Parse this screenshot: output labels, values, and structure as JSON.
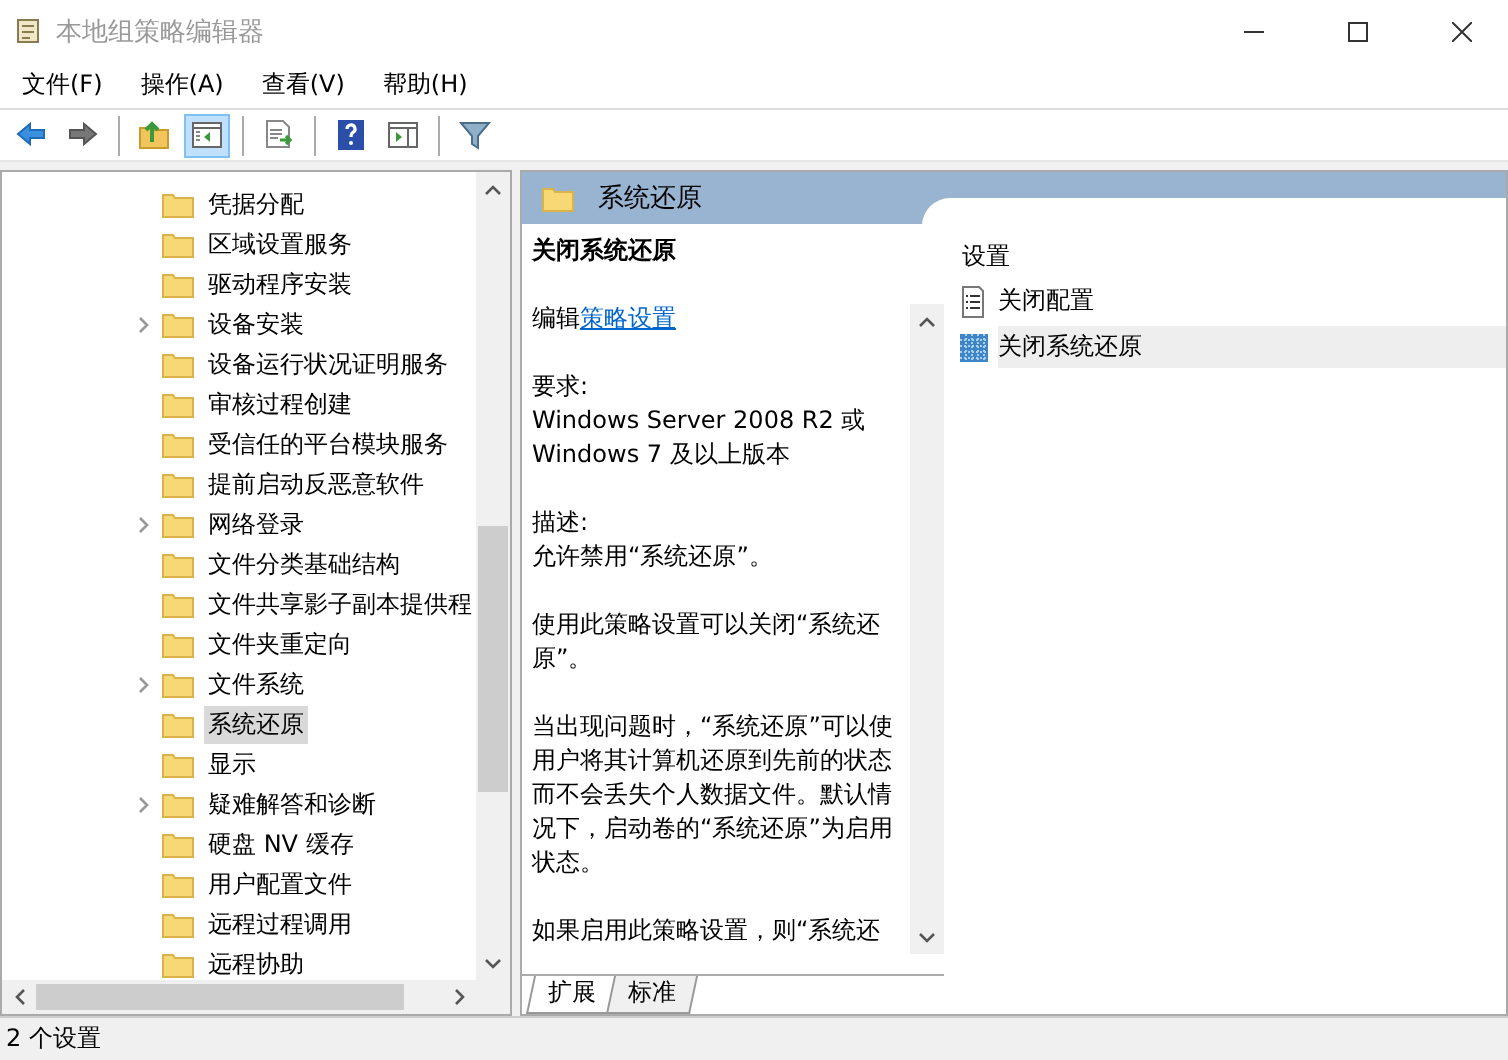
{
  "window": {
    "title": "本地组策略编辑器"
  },
  "menu": [
    "文件(F)",
    "操作(A)",
    "查看(V)",
    "帮助(H)"
  ],
  "toolbar": [
    [
      {
        "kind": "back",
        "selected": false
      },
      {
        "kind": "forward",
        "selected": false
      }
    ],
    [
      {
        "kind": "up",
        "selected": false
      },
      {
        "kind": "tree",
        "selected": true
      }
    ],
    [
      {
        "kind": "export",
        "selected": false
      }
    ],
    [
      {
        "kind": "help",
        "selected": false
      },
      {
        "kind": "panel",
        "selected": false
      }
    ],
    [
      {
        "kind": "filter",
        "selected": false
      }
    ]
  ],
  "tree": {
    "items": [
      {
        "label": "凭据分配",
        "expandable": false,
        "selected": false
      },
      {
        "label": "区域设置服务",
        "expandable": false,
        "selected": false
      },
      {
        "label": "驱动程序安装",
        "expandable": false,
        "selected": false
      },
      {
        "label": "设备安装",
        "expandable": true,
        "selected": false
      },
      {
        "label": "设备运行状况证明服务",
        "expandable": false,
        "selected": false
      },
      {
        "label": "审核过程创建",
        "expandable": false,
        "selected": false
      },
      {
        "label": "受信任的平台模块服务",
        "expandable": false,
        "selected": false
      },
      {
        "label": "提前启动反恶意软件",
        "expandable": false,
        "selected": false
      },
      {
        "label": "网络登录",
        "expandable": true,
        "selected": false
      },
      {
        "label": "文件分类基础结构",
        "expandable": false,
        "selected": false
      },
      {
        "label": "文件共享影子副本提供程",
        "expandable": false,
        "selected": false
      },
      {
        "label": "文件夹重定向",
        "expandable": false,
        "selected": false
      },
      {
        "label": "文件系统",
        "expandable": true,
        "selected": false
      },
      {
        "label": "系统还原",
        "expandable": false,
        "selected": true
      },
      {
        "label": "显示",
        "expandable": false,
        "selected": false
      },
      {
        "label": "疑难解答和诊断",
        "expandable": true,
        "selected": false
      },
      {
        "label": "硬盘 NV 缓存",
        "expandable": false,
        "selected": false
      },
      {
        "label": "用户配置文件",
        "expandable": false,
        "selected": false
      },
      {
        "label": "远程过程调用",
        "expandable": false,
        "selected": false
      },
      {
        "label": "远程协助",
        "expandable": false,
        "selected": false
      }
    ]
  },
  "header": {
    "title": "系统还原"
  },
  "detail": {
    "heading": "关闭系统还原",
    "edit_prefix": "编辑",
    "edit_link": "策略设置",
    "paragraphs": [
      "要求:\nWindows Server 2008 R2 或\nWindows 7 及以上版本",
      "描述:\n允许禁用“系统还原”。",
      "使用此策略设置可以关闭“系统还原”。",
      "当出现问题时，“系统还原”可以使用户将其计算机还原到先前的状态而不会丢失个人数据文件。默认情况下，启动卷的“系统还原”为启用状态。",
      "如果启用此策略设置，则“系统还"
    ]
  },
  "tabs": [
    {
      "label": "扩展",
      "selected": true
    },
    {
      "label": "标准",
      "selected": false
    }
  ],
  "settings": {
    "heading": "设置",
    "items": [
      {
        "label": "关闭配置",
        "kind": "policy",
        "selected": false
      },
      {
        "label": "关闭系统还原",
        "kind": "setting",
        "selected": true
      }
    ]
  },
  "status_bar": "2 个设置"
}
